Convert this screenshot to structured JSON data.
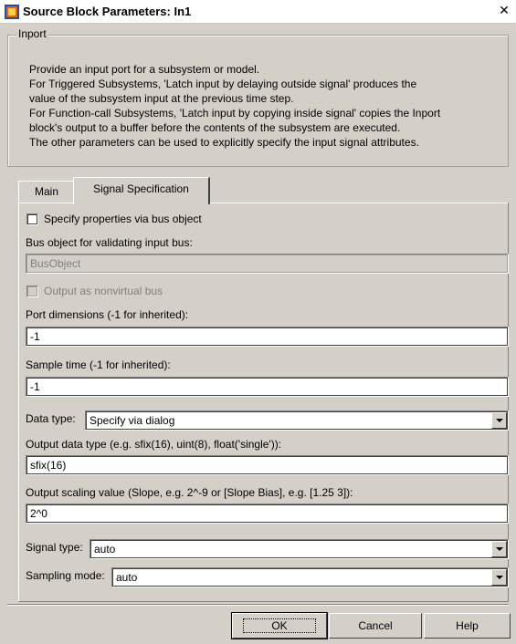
{
  "window": {
    "title": "Source Block Parameters: In1",
    "close_icon": "close-icon",
    "app_icon": "simulink-block-icon"
  },
  "group": {
    "legend": "Inport",
    "description": [
      "Provide an input port for a subsystem or model.",
      "For Triggered Subsystems, 'Latch input by delaying outside signal' produces the",
      "value of the subsystem input at the previous time step.",
      "For Function-call Subsystems, 'Latch input by copying inside signal' copies the Inport",
      "block's output to a buffer before the contents of the subsystem are executed.",
      "The other parameters can be used to explicitly specify the input signal attributes."
    ]
  },
  "tabs": [
    {
      "label": "Main",
      "active": false
    },
    {
      "label": "Signal Specification",
      "active": true
    }
  ],
  "form": {
    "bus_object_checkbox": {
      "label": "Specify properties via bus object",
      "checked": false
    },
    "bus_object_label": "Bus object for validating input bus:",
    "bus_object_value": "BusObject",
    "nonvirtual_checkbox": {
      "label": "Output as nonvirtual bus",
      "checked": false
    },
    "port_dimensions_label": "Port dimensions (-1 for inherited):",
    "port_dimensions_value": "-1",
    "sample_time_label": "Sample time (-1 for inherited):",
    "sample_time_value": "-1",
    "data_type_label": "Data type:",
    "data_type_value": "Specify via dialog",
    "output_data_type_label": "Output data type (e.g. sfix(16), uint(8), float('single')):",
    "output_data_type_value": "sfix(16)",
    "output_scaling_label": "Output scaling value (Slope, e.g. 2^-9 or [Slope Bias], e.g. [1.25 3]):",
    "output_scaling_value": "2^0",
    "signal_type_label": "Signal type:",
    "signal_type_value": "auto",
    "sampling_mode_label": "Sampling mode:",
    "sampling_mode_value": "auto"
  },
  "buttons": {
    "ok": "OK",
    "cancel": "Cancel",
    "help": "Help"
  }
}
